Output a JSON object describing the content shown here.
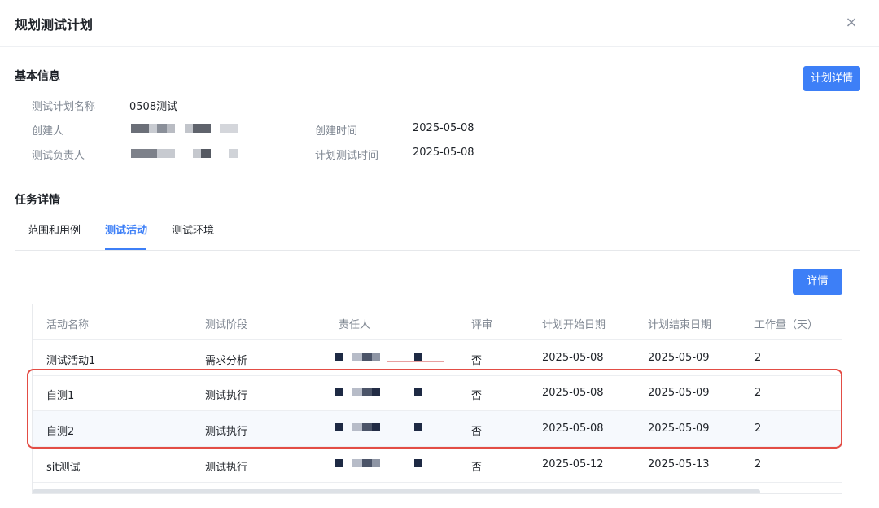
{
  "dialog": {
    "title": "规划测试计划",
    "close_symbol": "×"
  },
  "basic_info": {
    "section_title": "基本信息",
    "plan_detail_button": "计划详情",
    "plan_name_label": "测试计划名称",
    "plan_name_value": "0508测试",
    "creator_label": "创建人",
    "owner_label": "测试负责人",
    "created_time_label": "创建时间",
    "created_time_value": "2025-05-08",
    "plan_test_time_label": "计划测试时间",
    "plan_test_time_value": "2025-05-08"
  },
  "task_detail": {
    "section_title": "任务详情",
    "tabs": [
      {
        "label": "范围和用例",
        "active": false
      },
      {
        "label": "测试活动",
        "active": true
      },
      {
        "label": "测试环境",
        "active": false
      }
    ],
    "detail_button": "详情"
  },
  "table": {
    "columns": [
      "活动名称",
      "测试阶段",
      "责任人",
      "评审",
      "计划开始日期",
      "计划结束日期",
      "工作量（天）"
    ],
    "rows": [
      {
        "name": "测试活动1",
        "stage": "需求分析",
        "review": "否",
        "start": "2025-05-08",
        "end": "2025-05-09",
        "workload": "2"
      },
      {
        "name": "自测1",
        "stage": "测试执行",
        "review": "否",
        "start": "2025-05-08",
        "end": "2025-05-09",
        "workload": "2"
      },
      {
        "name": "自测2",
        "stage": "测试执行",
        "review": "否",
        "start": "2025-05-08",
        "end": "2025-05-09",
        "workload": "2"
      },
      {
        "name": "sit测试",
        "stage": "测试执行",
        "review": "否",
        "start": "2025-05-12",
        "end": "2025-05-13",
        "workload": "2"
      }
    ]
  },
  "colors": {
    "primary": "#3d7ff7",
    "highlight_border": "#e34d45",
    "label_gray": "#7f8792"
  },
  "icons": {
    "close": "close-icon"
  }
}
